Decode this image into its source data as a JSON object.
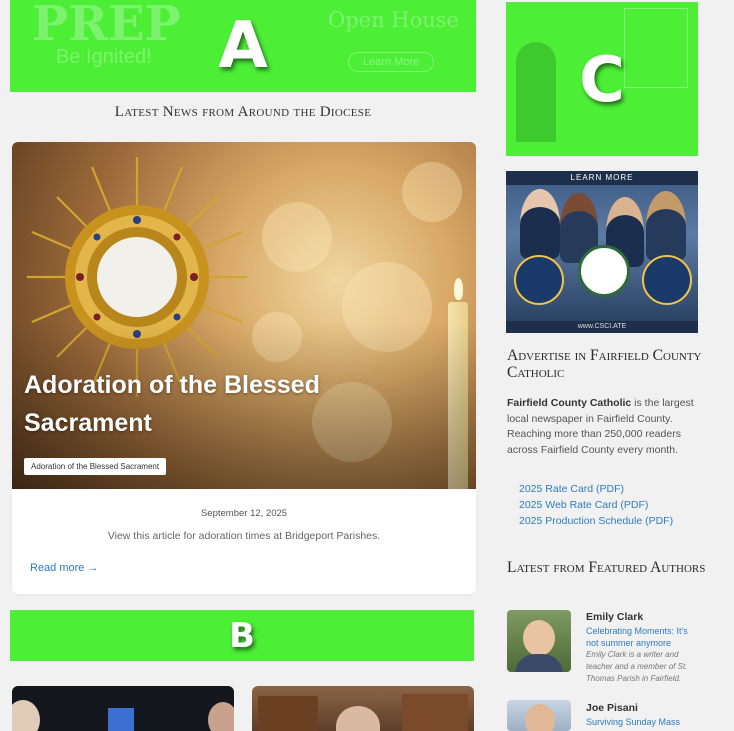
{
  "overlays": {
    "a_label": "A",
    "b_label": "B",
    "c_label": "C",
    "color": "#4cee36"
  },
  "top_banner": {
    "brand": "PREP",
    "tagline": "Be Ignited!",
    "event": "Open House",
    "button": "Learn More"
  },
  "news": {
    "section_title": "Latest News from Around the Diocese",
    "featured": {
      "title": "Adoration of the Blessed Sacrament",
      "tag": "Adoration of the Blessed Sacrament",
      "date": "September 12, 2025",
      "description": "View this article for adoration times at Bridgeport Parishes.",
      "read_more": "Read more",
      "read_more_icon": "arrow-right-icon"
    }
  },
  "sidebar": {
    "ad_banner": {
      "header": "LEARN MORE",
      "footer": "www.CSCI.ATE"
    },
    "advertise": {
      "title": "Advertise in Fairfield County Catholic",
      "body_bold": "Fairfield County Catholic",
      "body": " is the largest local newspaper in Fairfield County. Reaching more than 250,000 readers across Fairfield County every month.",
      "links": [
        "2025 Rate Card (PDF)",
        "2025 Web Rate Card (PDF)",
        "2025 Production Schedule (PDF)"
      ]
    },
    "authors": {
      "title": "Latest from Featured Authors",
      "items": [
        {
          "name": "Emily Clark",
          "article": "Celebrating Moments: It's not summer anymore",
          "bio": "Emily Clark is a writer and teacher and a member of St. Thomas Parish in Fairfield."
        },
        {
          "name": "Joe Pisani",
          "article": "Surviving Sunday Mass",
          "bio": ""
        }
      ]
    }
  },
  "colors": {
    "link": "#2f7cc0",
    "page_bg": "#f1f1f1",
    "overlay_green": "#4cee36"
  }
}
